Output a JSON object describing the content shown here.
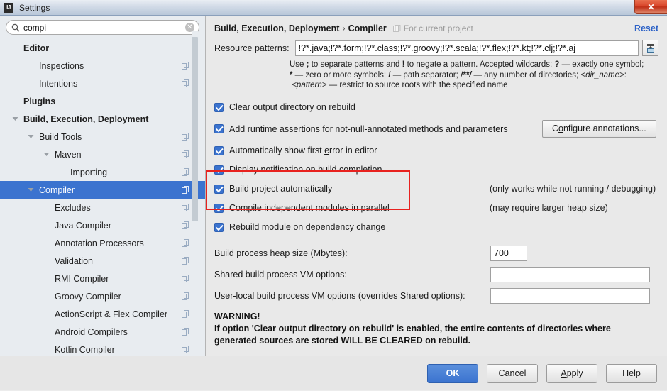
{
  "window": {
    "title": "Settings",
    "app_icon": "intellij-idea-icon",
    "close_label": "✕"
  },
  "search": {
    "value": "compi",
    "placeholder": "Search settings",
    "icon": "search-icon",
    "clear_icon": "clear-circle-icon"
  },
  "sidebar": {
    "items": [
      {
        "label": "Editor",
        "indent": 0,
        "bold": true,
        "expander": "none",
        "copy_icon": false,
        "selected": false
      },
      {
        "label": "Inspections",
        "indent": 1,
        "bold": false,
        "expander": "none",
        "copy_icon": true,
        "selected": false
      },
      {
        "label": "Intentions",
        "indent": 1,
        "bold": false,
        "expander": "none",
        "copy_icon": true,
        "selected": false
      },
      {
        "label": "Plugins",
        "indent": 0,
        "bold": true,
        "expander": "none",
        "copy_icon": false,
        "selected": false
      },
      {
        "label": "Build, Execution, Deployment",
        "indent": 0,
        "bold": true,
        "expander": "expanded",
        "copy_icon": false,
        "selected": false
      },
      {
        "label": "Build Tools",
        "indent": 1,
        "bold": false,
        "expander": "expanded",
        "copy_icon": true,
        "selected": false
      },
      {
        "label": "Maven",
        "indent": 2,
        "bold": false,
        "expander": "expanded",
        "copy_icon": true,
        "selected": false
      },
      {
        "label": "Importing",
        "indent": 3,
        "bold": false,
        "expander": "none",
        "copy_icon": true,
        "selected": false
      },
      {
        "label": "Compiler",
        "indent": 1,
        "bold": false,
        "expander": "expanded",
        "copy_icon": true,
        "selected": true
      },
      {
        "label": "Excludes",
        "indent": 2,
        "bold": false,
        "expander": "none",
        "copy_icon": true,
        "selected": false
      },
      {
        "label": "Java Compiler",
        "indent": 2,
        "bold": false,
        "expander": "none",
        "copy_icon": true,
        "selected": false
      },
      {
        "label": "Annotation Processors",
        "indent": 2,
        "bold": false,
        "expander": "none",
        "copy_icon": true,
        "selected": false
      },
      {
        "label": "Validation",
        "indent": 2,
        "bold": false,
        "expander": "none",
        "copy_icon": true,
        "selected": false
      },
      {
        "label": "RMI Compiler",
        "indent": 2,
        "bold": false,
        "expander": "none",
        "copy_icon": true,
        "selected": false
      },
      {
        "label": "Groovy Compiler",
        "indent": 2,
        "bold": false,
        "expander": "none",
        "copy_icon": true,
        "selected": false
      },
      {
        "label": "ActionScript & Flex Compiler",
        "indent": 2,
        "bold": false,
        "expander": "none",
        "copy_icon": true,
        "selected": false
      },
      {
        "label": "Android Compilers",
        "indent": 2,
        "bold": false,
        "expander": "none",
        "copy_icon": true,
        "selected": false
      },
      {
        "label": "Kotlin Compiler",
        "indent": 2,
        "bold": false,
        "expander": "none",
        "copy_icon": true,
        "selected": false
      }
    ]
  },
  "main": {
    "breadcrumb": {
      "parent": "Build, Execution, Deployment",
      "separator": "›",
      "current": "Compiler",
      "scope_icon": "project-scope-icon",
      "scope": "For current project"
    },
    "reset_label": "Reset",
    "resource_patterns": {
      "label": "Resource patterns:",
      "value": "!?*.java;!?*.form;!?*.class;!?*.groovy;!?*.scala;!?*.flex;!?*.kt;!?*.clj;!?*.aj",
      "expand_button_icon": "expand-field-icon"
    },
    "hint": {
      "line1_a": "Use ",
      "line1_semicolon": ";",
      "line1_b": " to separate patterns and ",
      "line1_bang": "!",
      "line1_c": " to negate a pattern. Accepted wildcards: ",
      "line1_q": "?",
      "line1_d": " — exactly one symbol;",
      "line2_star": "*",
      "line2_a": " — zero or more symbols; ",
      "line2_slash": "/",
      "line2_b": " — path separator; ",
      "line2_globstar": "/**/",
      "line2_c": " — any number of directories; ",
      "line2_dirname": "<dir_name>",
      "line2_colon": ":",
      "line3_pattern": "<pattern>",
      "line3_a": " — restrict to source roots with the specified name"
    },
    "checkboxes": [
      {
        "label_pre": "C",
        "label_mnemonic": "l",
        "label_post": "ear output directory on rebuild",
        "checked": true,
        "note": ""
      },
      {
        "label_pre": "Add runtime ",
        "label_mnemonic": "a",
        "label_post": "ssertions for not-null-annotated methods and parameters",
        "checked": true,
        "note": ""
      },
      {
        "label_pre": "Automatically show first ",
        "label_mnemonic": "e",
        "label_post": "rror in editor",
        "checked": true,
        "note": ""
      },
      {
        "label_pre": "Display notification on build completion",
        "label_mnemonic": "",
        "label_post": "",
        "checked": true,
        "note": ""
      },
      {
        "label_pre": "Build project automatically",
        "label_mnemonic": "",
        "label_post": "",
        "checked": true,
        "note": "(only works while not running / debugging)"
      },
      {
        "label_pre": "Compile independent modules in parallel",
        "label_mnemonic": "",
        "label_post": "",
        "checked": true,
        "note": "(may require larger heap size)"
      },
      {
        "label_pre": "Rebuild module on dependency change",
        "label_mnemonic": "",
        "label_post": "",
        "checked": true,
        "note": ""
      }
    ],
    "configure_annotations": {
      "pre": "C",
      "mnemonic": "o",
      "post": "nfigure annotations..."
    },
    "fields": [
      {
        "label": "Build process heap size (Mbytes):",
        "value": "700",
        "kind": "small"
      },
      {
        "label": "Shared build process VM options:",
        "value": "",
        "kind": "wide"
      },
      {
        "label": "User-local build process VM options (overrides Shared options):",
        "value": "",
        "kind": "wide"
      }
    ],
    "warning": {
      "title": "WARNING!",
      "line1": "If option 'Clear output directory on rebuild' is enabled, the entire contents of directories where",
      "line2": "generated sources are stored WILL BE CLEARED on rebuild."
    },
    "highlight_color": "#e8221f"
  },
  "footer": {
    "ok": "OK",
    "cancel": "Cancel",
    "apply_pre": "",
    "apply_mnemonic": "A",
    "apply_post": "pply",
    "help": "Help"
  }
}
